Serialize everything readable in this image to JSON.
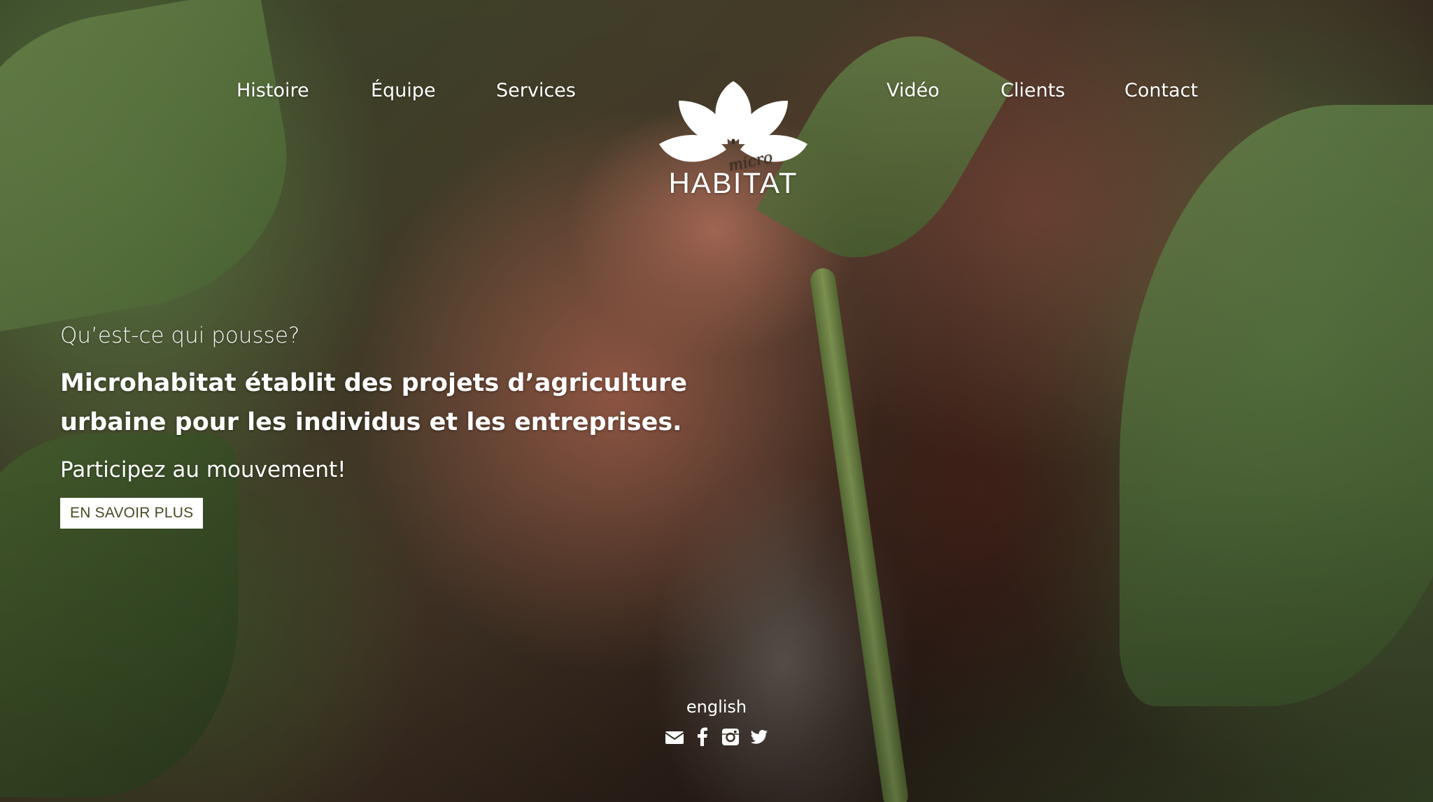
{
  "nav": {
    "left": [
      "Histoire",
      "Équipe",
      "Services"
    ],
    "right": [
      "Vidéo",
      "Clients",
      "Contact"
    ]
  },
  "logo": {
    "script_text": "micro",
    "wordmark": "HABITAT"
  },
  "hero": {
    "kicker": "Qu’est-ce qui pousse?",
    "title": "Microhabitat établit des projets d’agriculture urbaine pour les individus et les entreprises.",
    "cta_text": "Participez au mouvement!",
    "button_label": "EN SAVOIR PLUS"
  },
  "footer": {
    "language_link": "english",
    "social_icons": [
      "envelope-icon",
      "facebook-icon",
      "instagram-icon",
      "twitter-icon"
    ]
  },
  "colors": {
    "button_text": "#4a4a22",
    "button_bg": "#ffffff",
    "text": "#ffffff"
  }
}
